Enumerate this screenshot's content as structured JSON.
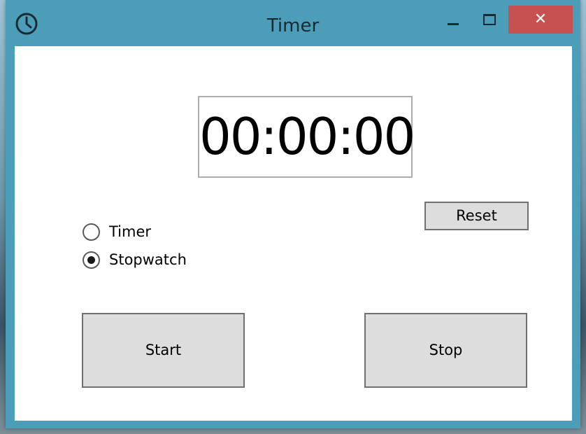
{
  "window": {
    "title": "Timer",
    "icon": "clock-icon",
    "controls": {
      "minimize": "minimize-icon",
      "maximize": "maximize-icon",
      "close": "close-icon",
      "close_glyph": "✕"
    },
    "colors": {
      "frame": "#4b9db8",
      "close_bg": "#c75050"
    }
  },
  "display": {
    "time": "00:00:00"
  },
  "reset": {
    "label": "Reset"
  },
  "mode": {
    "options": [
      {
        "label": "Timer",
        "selected": false
      },
      {
        "label": "Stopwatch",
        "selected": true
      }
    ]
  },
  "actions": {
    "start_label": "Start",
    "stop_label": "Stop"
  }
}
